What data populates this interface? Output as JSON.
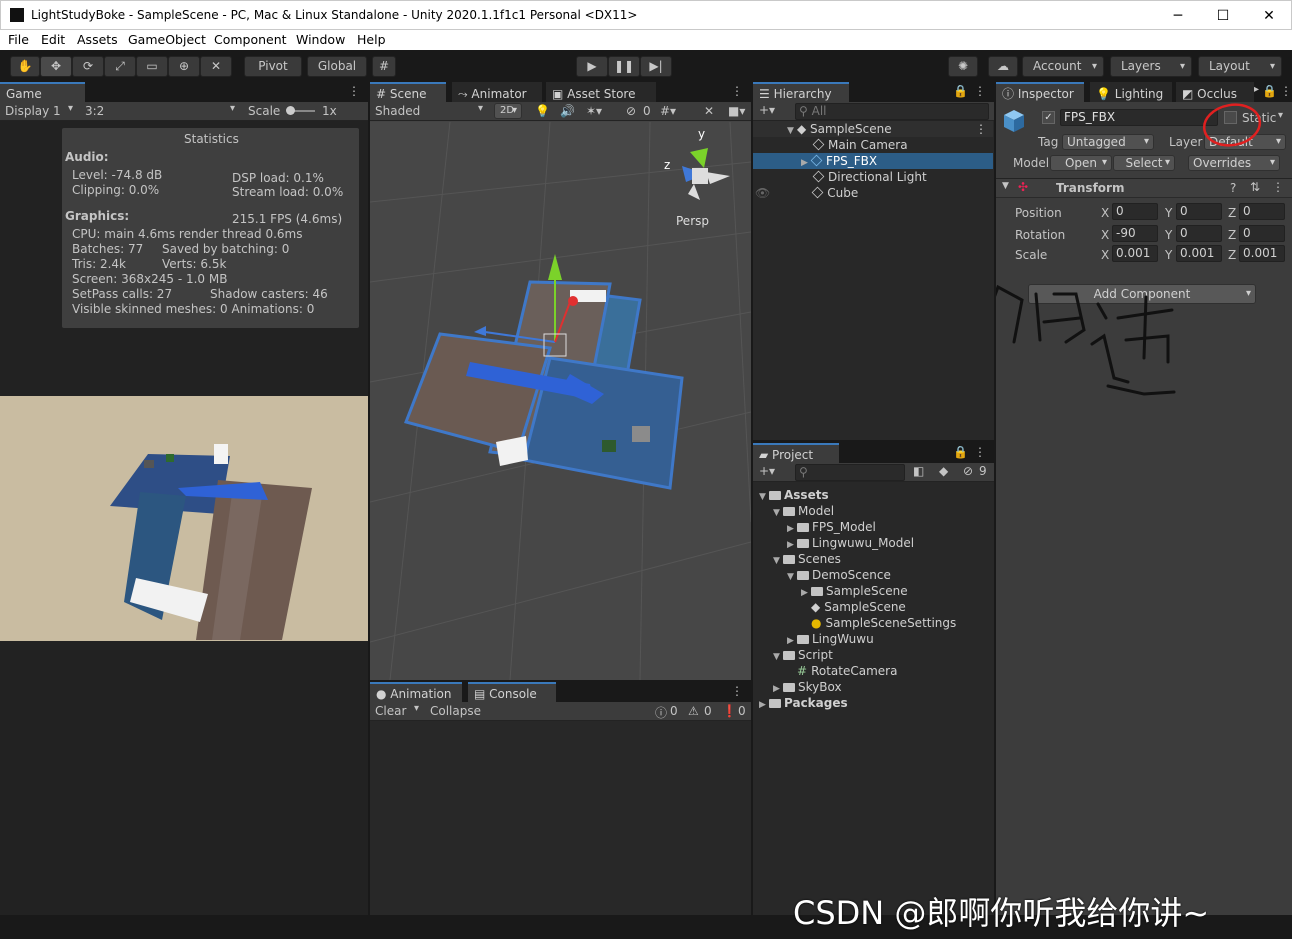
{
  "window": {
    "title": "LightStudyBoke - SampleScene - PC, Mac & Linux Standalone - Unity 2020.1.1f1c1 Personal <DX11>",
    "minimize": "─",
    "maximize": "☐",
    "close": "✕"
  },
  "menu": [
    "File",
    "Edit",
    "Assets",
    "GameObject",
    "Component",
    "Window",
    "Help"
  ],
  "toolbar": {
    "pivot": "Pivot",
    "global": "Global",
    "account": "Account",
    "layers": "Layers",
    "layout": "Layout"
  },
  "game": {
    "tab": "Game",
    "display": "Display 1",
    "aspect": "3:2",
    "scale_label": "Scale",
    "scale_value": "1x",
    "stats": {
      "title": "Statistics",
      "audio_label": "Audio:",
      "level": "Level: -74.8 dB",
      "dsp": "DSP load: 0.1%",
      "clipping": "Clipping: 0.0%",
      "stream": "Stream load: 0.0%",
      "graphics_label": "Graphics:",
      "fps": "215.1 FPS (4.6ms)",
      "cpu": "CPU: main 4.6ms  render thread 0.6ms",
      "batches": "Batches: 77",
      "saved": "Saved by batching: 0",
      "tris": "Tris: 2.4k",
      "verts": "Verts: 6.5k",
      "screen": "Screen: 368x245 - 1.0 MB",
      "setpass": "SetPass calls: 27",
      "shadow": "Shadow casters: 46",
      "skinned": "Visible skinned meshes: 0  Animations: 0"
    }
  },
  "scene": {
    "tab_scene": "Scene",
    "tab_animator": "Animator",
    "tab_store": "Asset Store",
    "shaded": "Shaded",
    "mode2d": "2D",
    "hidden_count": "0",
    "persp": "Persp",
    "axis_y": "y",
    "axis_z": "z"
  },
  "console": {
    "tab_animation": "Animation",
    "tab_console": "Console",
    "clear": "Clear",
    "collapse": "Collapse",
    "c1": "0",
    "c2": "0",
    "c3": "0"
  },
  "hierarchy": {
    "tab": "Hierarchy",
    "search": "All",
    "root": "SampleScene",
    "items": [
      "Main Camera",
      "FPS_FBX",
      "Directional Light",
      "Cube"
    ]
  },
  "project": {
    "tab": "Project",
    "hidden": "9",
    "tree": [
      {
        "label": "Assets",
        "indent": 0,
        "bold": true
      },
      {
        "label": "Model",
        "indent": 1
      },
      {
        "label": "FPS_Model",
        "indent": 2
      },
      {
        "label": "Lingwuwu_Model",
        "indent": 2
      },
      {
        "label": "Scenes",
        "indent": 1
      },
      {
        "label": "DemoScence",
        "indent": 2
      },
      {
        "label": "SampleScene",
        "indent": 3
      },
      {
        "label": "SampleScene",
        "indent": 3
      },
      {
        "label": "SampleSceneSettings",
        "indent": 3
      },
      {
        "label": "LingWuwu",
        "indent": 2
      },
      {
        "label": "Script",
        "indent": 1
      },
      {
        "label": "RotateCamera",
        "indent": 2
      },
      {
        "label": "SkyBox",
        "indent": 1
      },
      {
        "label": "Packages",
        "indent": 0,
        "bold": true
      }
    ]
  },
  "inspector": {
    "tab_inspector": "Inspector",
    "tab_lighting": "Lighting",
    "tab_occlusion": "Occlus",
    "name": "FPS_FBX",
    "static": "Static",
    "tag_label": "Tag",
    "tag": "Untagged",
    "layer_label": "Layer",
    "layer": "Default",
    "model_label": "Model",
    "open": "Open",
    "select": "Select",
    "overrides": "Overrides",
    "transform": "Transform",
    "position": {
      "label": "Position",
      "x": "0",
      "y": "0",
      "z": "0"
    },
    "rotation": {
      "label": "Rotation",
      "x": "-90",
      "y": "0",
      "z": "0"
    },
    "scale": {
      "label": "Scale",
      "x": "0.001",
      "y": "0.001",
      "z": "0.001"
    },
    "add_component": "Add Component"
  },
  "watermark": "CSDN @郎啊你听我给你讲~",
  "colors": {
    "accent": "#3a79bb",
    "annotation": "#e02020"
  }
}
